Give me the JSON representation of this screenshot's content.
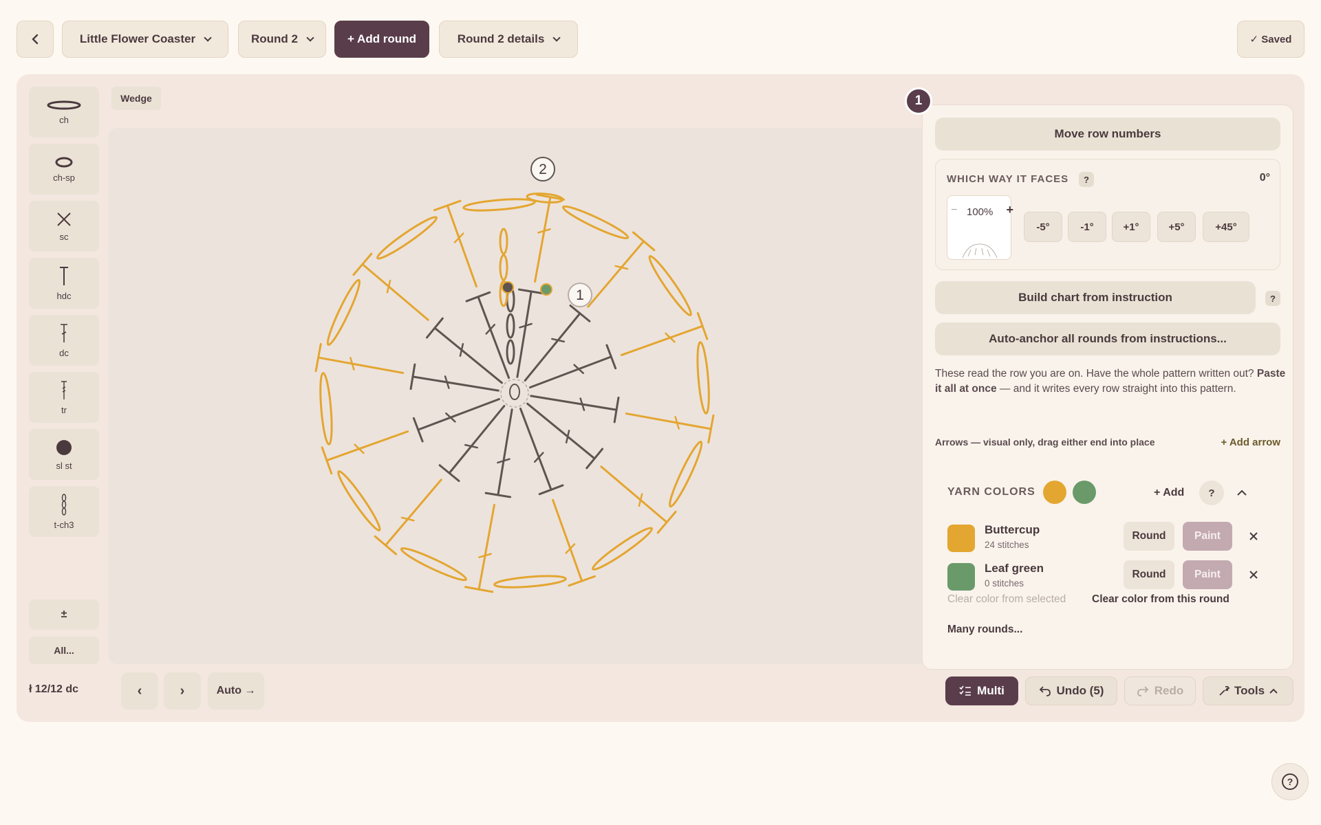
{
  "topbar": {
    "pattern_name": "Little Flower Coaster",
    "round_select": "Round 2",
    "add_round": "+ Add round",
    "round_details": "Round 2 details",
    "saved": "✓ Saved"
  },
  "toolbar": {
    "tools": [
      {
        "label": "ch",
        "icon": "chain-icon"
      },
      {
        "label": "ch-sp",
        "icon": "chain-space-icon"
      },
      {
        "label": "sc",
        "icon": "single-crochet-icon"
      },
      {
        "label": "hdc",
        "icon": "half-double-crochet-icon"
      },
      {
        "label": "dc",
        "icon": "double-crochet-icon"
      },
      {
        "label": "tr",
        "icon": "treble-crochet-icon"
      },
      {
        "label": "sl st",
        "icon": "slip-stitch-icon"
      },
      {
        "label": "t-ch3",
        "icon": "turning-chain-icon"
      }
    ],
    "plusminus": "±",
    "all": "All..."
  },
  "canvas": {
    "wedge_label": "Wedge",
    "round_markers": [
      "2",
      "1"
    ]
  },
  "panel": {
    "step_badge": "1",
    "move_row_numbers": "Move row numbers",
    "facing": {
      "title": "WHICH WAY IT FACES",
      "help": "?",
      "angle": "0°",
      "zoom": "100%",
      "zoom_minus": "–",
      "zoom_plus": "+",
      "rotate_buttons": [
        "-5°",
        "-1°",
        "+1°",
        "+5°",
        "+45°"
      ]
    },
    "build_chart": "Build chart from instruction",
    "build_help": "?",
    "auto_anchor": "Auto-anchor all rounds from instructions...",
    "help_text_1": "These read the row you are on. Have the whole pattern written out?",
    "help_text_bold": "Paste it all at once",
    "help_text_2": " — and it writes every row straight into this pattern.",
    "arrows_text": "Arrows — visual only, drag either end into place",
    "add_arrow": "+ Add arrow",
    "yarn": {
      "title": "YARN COLORS",
      "add": "+ Add",
      "help": "?",
      "colors": [
        {
          "name": "Buttercup",
          "count": "24 stitches",
          "color": "#e3a630",
          "round": "Round",
          "paint": "Paint"
        },
        {
          "name": "Leaf green",
          "count": "0 stitches",
          "color": "#6a9a6a",
          "round": "Round",
          "paint": "Paint"
        }
      ],
      "clear_selected": "Clear color from selected",
      "clear_round": "Clear color from this round",
      "many_rounds": "Many rounds..."
    }
  },
  "bottombar": {
    "status": "ł 12/12 dc",
    "prev": "‹",
    "next": "›",
    "auto": "Auto →",
    "multi": "Multi",
    "undo": "Undo (5)",
    "redo": "Redo",
    "tools": "Tools"
  },
  "help_fab": "?",
  "colors": {
    "plum": "#5a3d4b",
    "buttercup": "#e3a630",
    "leaf": "#6a9a6a",
    "stitch": "#5e5450"
  }
}
